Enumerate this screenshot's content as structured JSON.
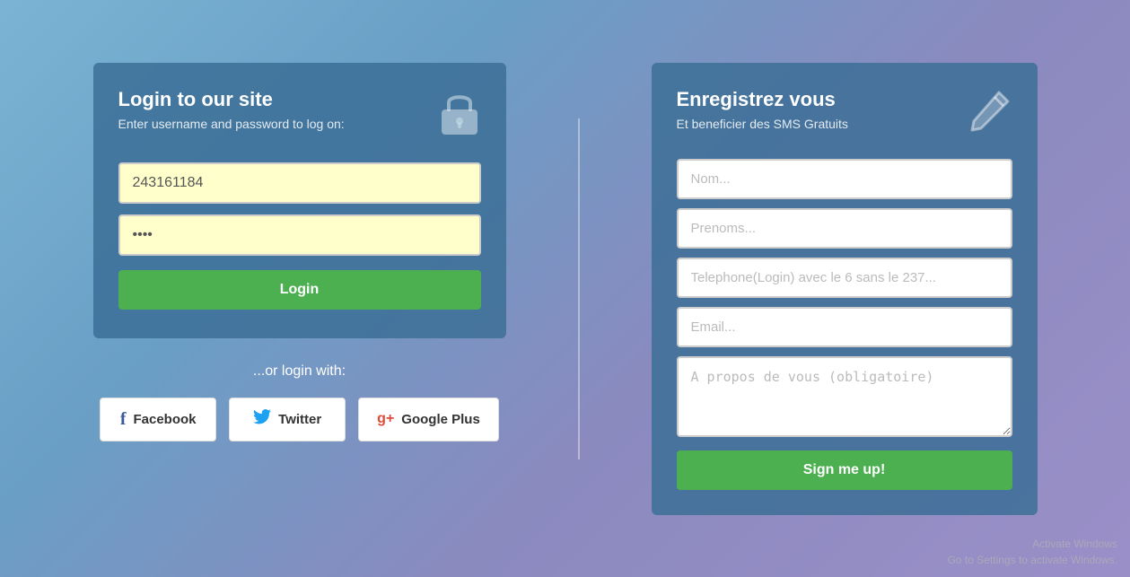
{
  "login": {
    "title": "Login to our site",
    "subtitle": "Enter username and password to log on:",
    "username_value": "243161184",
    "password_placeholder": "••••",
    "login_button": "Login",
    "or_text": "...or login with:",
    "social": [
      {
        "id": "facebook",
        "label": "Facebook",
        "icon": "f"
      },
      {
        "id": "twitter",
        "label": "Twitter",
        "icon": "🐦"
      },
      {
        "id": "googleplus",
        "label": "Google Plus",
        "icon": "g+"
      }
    ]
  },
  "register": {
    "title": "Enregistrez vous",
    "subtitle": "Et beneficier des SMS Gratuits",
    "fields": [
      {
        "id": "nom",
        "placeholder": "Nom..."
      },
      {
        "id": "prenoms",
        "placeholder": "Prenoms..."
      },
      {
        "id": "telephone",
        "placeholder": "Telephone(Login) avec le 6 sans le 237..."
      },
      {
        "id": "email",
        "placeholder": "Email..."
      }
    ],
    "textarea_placeholder": "A propos de vous (obligatoire)",
    "signup_button": "Sign me up!"
  },
  "watermark": {
    "line1": "Activate Windows",
    "line2": "Go to Settings to activate Windows."
  }
}
